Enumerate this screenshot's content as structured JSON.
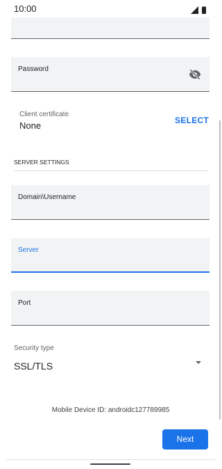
{
  "status_bar": {
    "time": "10:00",
    "icons": [
      "signal-icon",
      "battery-icon"
    ]
  },
  "form": {
    "top_field": {
      "label": "",
      "value": ""
    },
    "password": {
      "label": "Password",
      "value": "",
      "toggle_icon": "visibility-off-icon"
    },
    "client_certificate": {
      "label": "Client certificate",
      "value": "None",
      "action": "SELECT"
    },
    "server_settings": {
      "header": "SERVER SETTINGS",
      "domain_username": {
        "label": "Domain\\Username",
        "value": ""
      },
      "server": {
        "label": "Server",
        "value": "",
        "focused": true
      },
      "port": {
        "label": "Port",
        "value": ""
      },
      "security_type": {
        "label": "Security type",
        "value": "SSL/TLS",
        "icon": "dropdown-arrow-icon"
      }
    }
  },
  "footer": {
    "device_id": "Mobile Device ID: androidc127789985",
    "next_label": "Next"
  },
  "colors": {
    "accent": "#1a73e8",
    "field_bg": "#f1f3f4",
    "text": "#202124"
  }
}
